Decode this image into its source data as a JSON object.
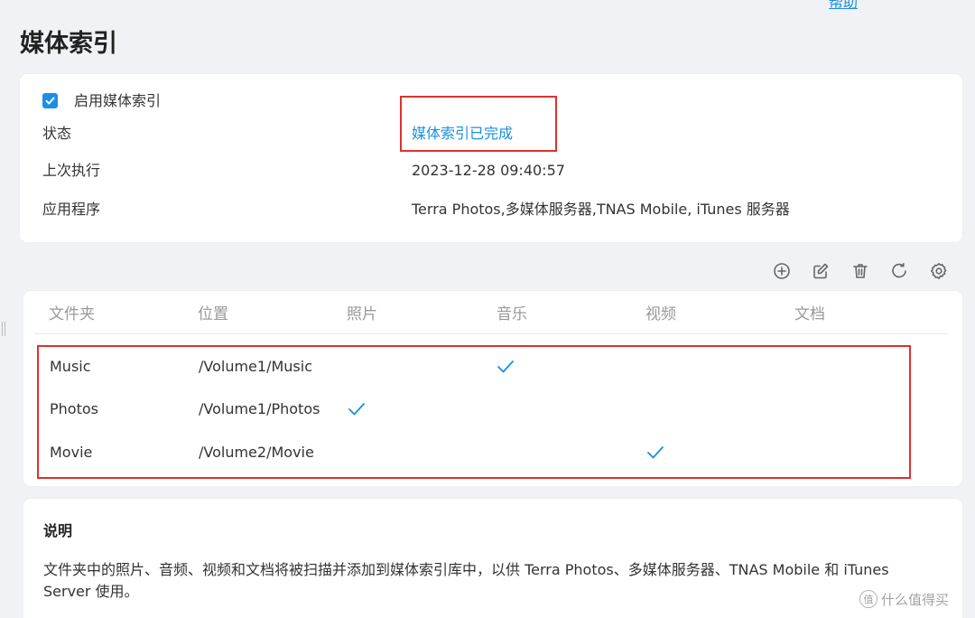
{
  "window": {
    "help_label": "帮助"
  },
  "page": {
    "title": "媒体索引"
  },
  "info": {
    "enable_label": "启用媒体索引",
    "enable_checked": true,
    "rows": [
      {
        "label": "状态",
        "value": "媒体索引已完成"
      },
      {
        "label": "上次执行",
        "value": "2023-12-28 09:40:57"
      },
      {
        "label": "应用程序",
        "value": "Terra Photos,多媒体服务器,TNAS Mobile, iTunes 服务器"
      }
    ]
  },
  "toolbar": {
    "icons": [
      "add-icon",
      "edit-icon",
      "delete-icon",
      "refresh-icon",
      "settings-icon"
    ]
  },
  "table": {
    "columns": [
      "文件夹",
      "位置",
      "照片",
      "音乐",
      "视频",
      "文档"
    ],
    "rows": [
      {
        "folder": "Music",
        "location": "/Volume1/Music",
        "photo": false,
        "music": true,
        "video": false,
        "document": false
      },
      {
        "folder": "Photos",
        "location": "/Volume1/Photos",
        "photo": true,
        "music": false,
        "video": false,
        "document": false
      },
      {
        "folder": "Movie",
        "location": "/Volume2/Movie",
        "photo": false,
        "music": false,
        "video": true,
        "document": false
      }
    ]
  },
  "description": {
    "title": "说明",
    "text": "文件夹中的照片、音频、视频和文档将被扫描并添加到媒体索引库中，以供 Terra Photos、多媒体服务器、TNAS Mobile 和 iTunes Server 使用。"
  },
  "watermark": {
    "text": "什么值得买",
    "logo_glyph": "值"
  },
  "colors": {
    "accent": "#1a8fe3",
    "annotation": "#e0312f",
    "background": "#f1f2f5"
  }
}
